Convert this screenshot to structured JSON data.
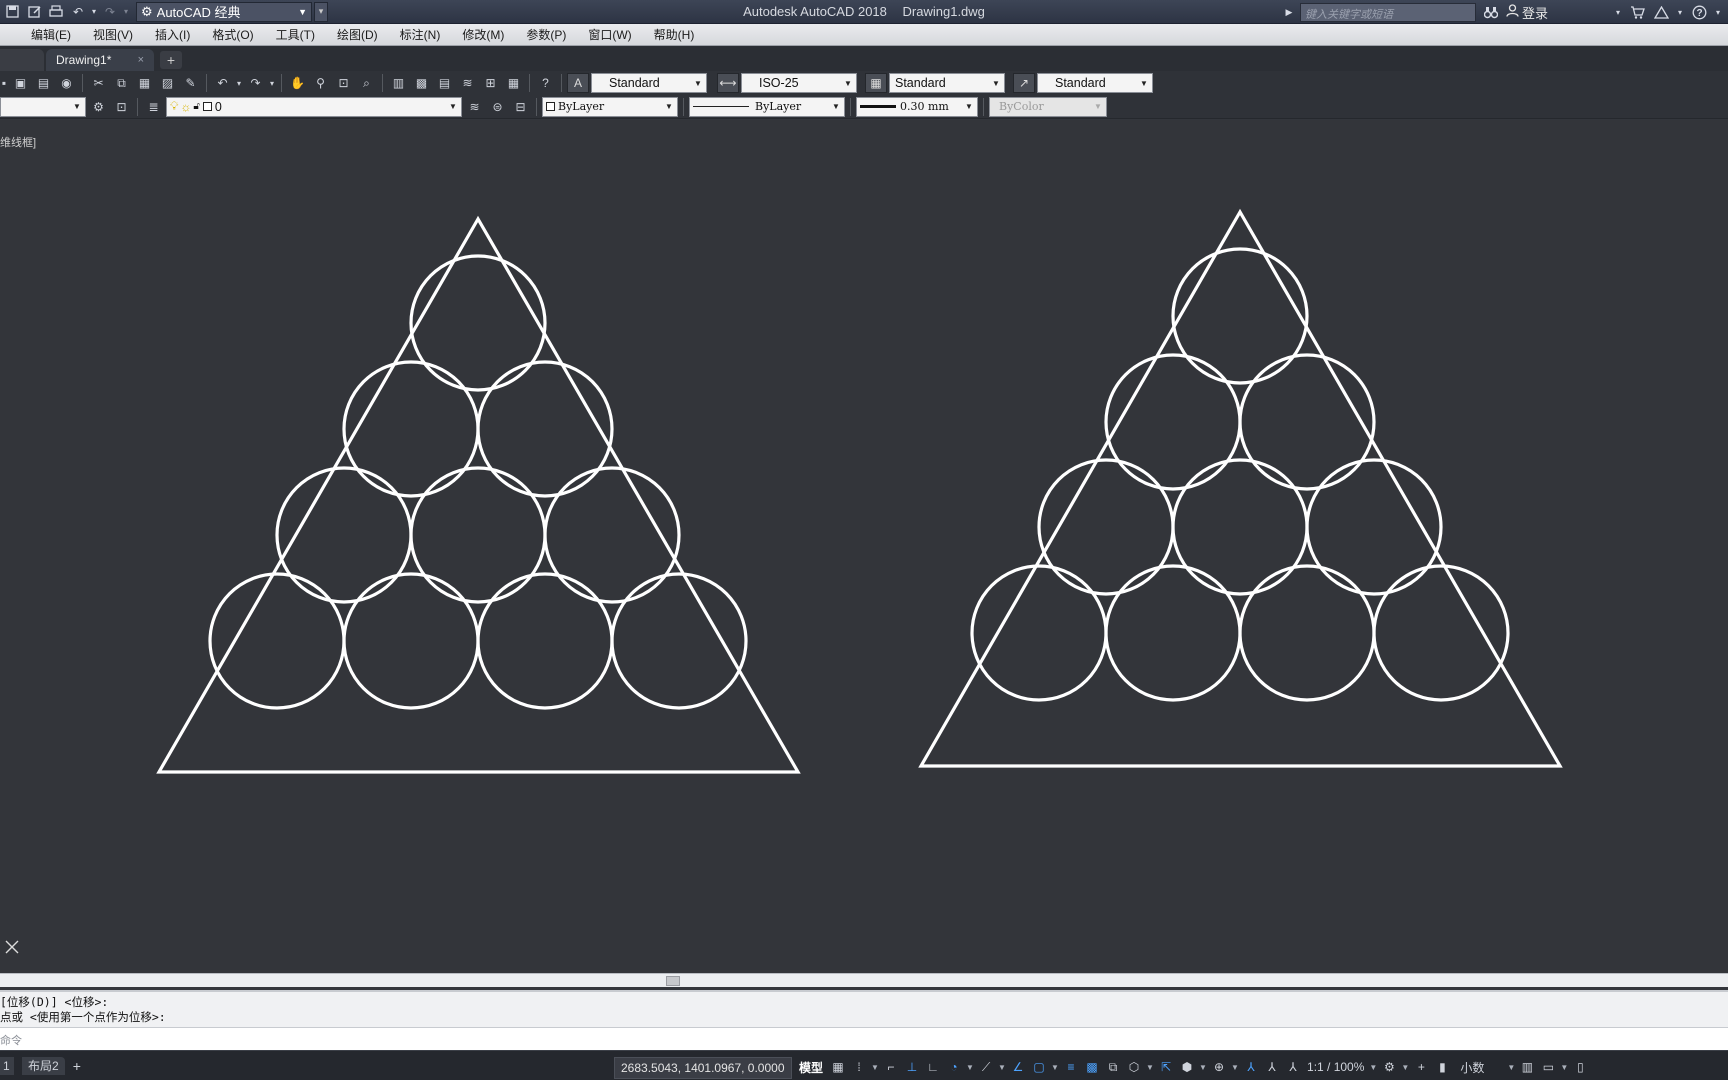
{
  "titlebar": {
    "workspace": "AutoCAD 经典",
    "app_name": "Autodesk AutoCAD 2018",
    "file_name": "Drawing1.dwg",
    "search_placeholder": "键入关键字或短语",
    "login_label": "登录"
  },
  "menubar": {
    "items": [
      "编辑(E)",
      "视图(V)",
      "插入(I)",
      "格式(O)",
      "工具(T)",
      "绘图(D)",
      "标注(N)",
      "修改(M)",
      "参数(P)",
      "窗口(W)",
      "帮助(H)"
    ]
  },
  "tabs": {
    "active_tab": "Drawing1*",
    "close_glyph": "×",
    "add_glyph": "+"
  },
  "styles_toolbar": {
    "text_style": "Standard",
    "dim_style": "ISO-25",
    "table_style": "Standard",
    "mleader_style": "Standard"
  },
  "layers_toolbar": {
    "layer_name": "0",
    "color": "ByLayer",
    "linetype": "ByLayer",
    "lineweight": "0.30 mm",
    "plotstyle": "ByColor"
  },
  "viewport": {
    "label": "维线框]",
    "background": "#33353a",
    "line_color": "#ffffff"
  },
  "drawing": {
    "shapes": [
      "triangle-with-10-circles",
      "triangle-with-10-circles"
    ]
  },
  "command": {
    "history_line1": "[位移(D)] <位移>:",
    "history_line2": "点或 <使用第一个点作为位移>:",
    "prompt": "命令"
  },
  "statusbar": {
    "layout_tab_1": "1",
    "layout_tab_2": "布局2",
    "add_glyph": "+",
    "coordinates": "2683.5043, 1401.0967, 0.0000",
    "model_label": "模型",
    "annotation_scale": "1:1 / 100%",
    "units": "小数"
  }
}
